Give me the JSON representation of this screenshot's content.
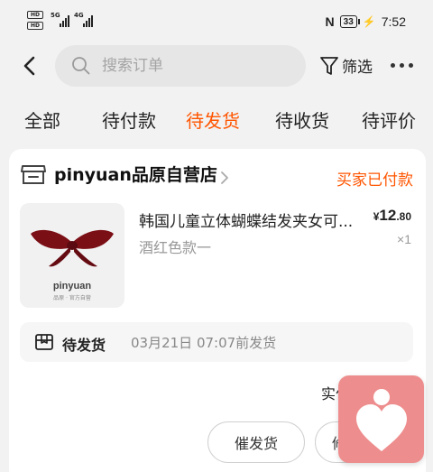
{
  "status_bar": {
    "hd1": "HD",
    "hd2": "HD",
    "net1": "5G",
    "net2": "4G",
    "nfc": "N",
    "battery": "33",
    "time": "7:52"
  },
  "header": {
    "search_placeholder": "搜索订单",
    "filter_label": "筛选"
  },
  "tabs": [
    {
      "label": "全部"
    },
    {
      "label": "待付款"
    },
    {
      "label": "待发货",
      "active": true
    },
    {
      "label": "待收货"
    },
    {
      "label": "待评价"
    }
  ],
  "order": {
    "shop_name": "pinyuan品原自营店",
    "status": "买家已付款",
    "product": {
      "title": "韩国儿童立体蝴蝶结发夹女可...",
      "variant": "酒红色款一",
      "price_currency": "¥",
      "price_int": "12",
      "price_cents": ".80",
      "quantity": "×1",
      "image_brand": "pinyuan",
      "image_sub": "品原 · 官方自营"
    },
    "shipping": {
      "label": "待发货",
      "deadline": "03月21日 07:07前发货"
    },
    "paid_label": "实付",
    "buttons": {
      "urge": "催发货",
      "second": "修"
    }
  },
  "colors": {
    "accent": "#ff5500",
    "widget": "#ee8d8d"
  }
}
